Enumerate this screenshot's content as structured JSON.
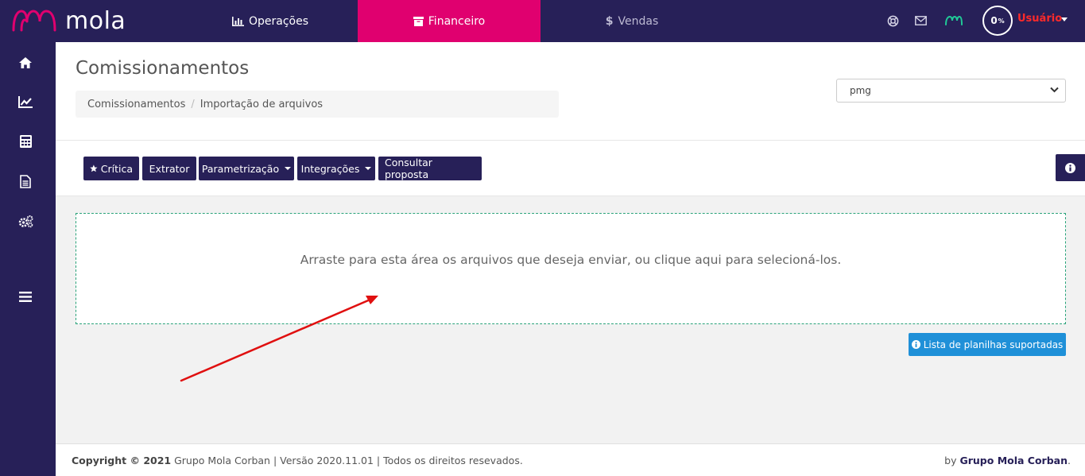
{
  "brand": {
    "name": "mola"
  },
  "nav": {
    "tabs": [
      {
        "label": "Operações",
        "icon": "bar-chart-icon"
      },
      {
        "label": "Financeiro",
        "icon": "archive-icon",
        "active": true
      },
      {
        "label": "Vendas",
        "icon": "dollar-icon"
      }
    ]
  },
  "topbar": {
    "progress_value": "0",
    "progress_unit": "%",
    "user_name": "Usuário"
  },
  "header": {
    "title": "Comissionamentos",
    "breadcrumb": [
      "Comissionamentos",
      "Importação de arquivos"
    ],
    "select_value": "pmg"
  },
  "toolbar": {
    "buttons": [
      {
        "label": "Crítica"
      },
      {
        "label": "Extrator"
      },
      {
        "label": "Parametrização"
      },
      {
        "label": "Integrações"
      },
      {
        "label": "Consultar proposta"
      }
    ]
  },
  "dropzone": {
    "text": "Arraste para esta área os arquivos que deseja enviar, ou clique aqui para selecioná-los."
  },
  "list_button": {
    "label": "Lista de planilhas suportadas"
  },
  "footer": {
    "copyright_label": "Copyright © 2021",
    "company": "Grupo Mola Corban",
    "version_text": "| Versão 2020.11.01 | Todos os direitos resevados.",
    "by_label": "by",
    "by_company": "Grupo Mola Corban",
    "by_suffix": "."
  },
  "colors": {
    "primary": "#272058",
    "accent": "#e0006f",
    "info": "#1f90d8",
    "dropzone_border": "#2aa37a",
    "annotation_arrow": "#e01010"
  }
}
